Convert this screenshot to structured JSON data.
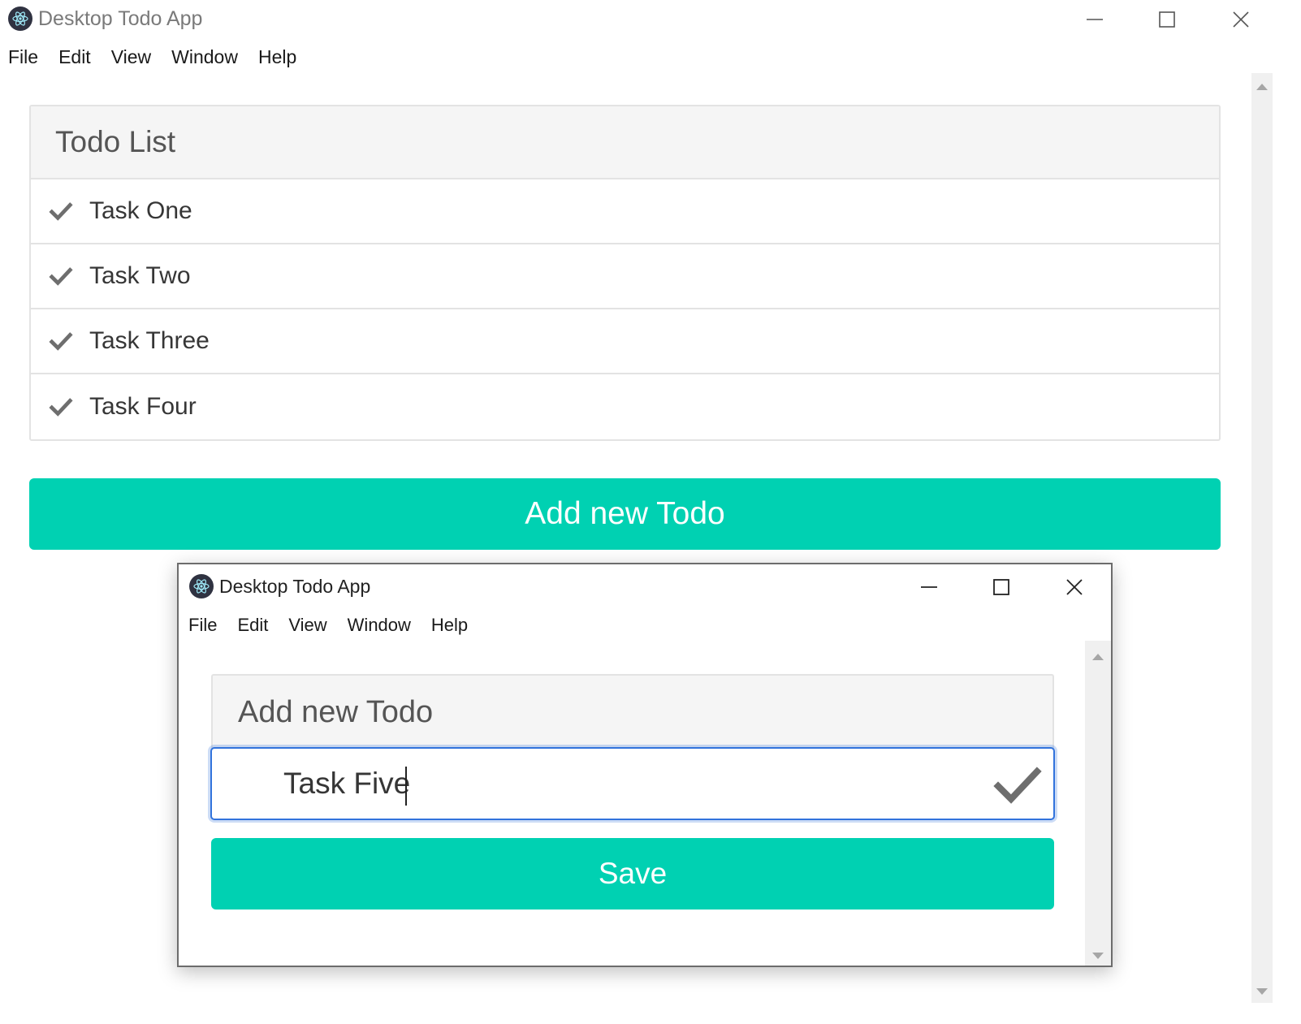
{
  "main_window": {
    "title": "Desktop Todo App",
    "menu": [
      "File",
      "Edit",
      "View",
      "Window",
      "Help"
    ],
    "panel": {
      "heading": "Todo List",
      "tasks": [
        "Task One",
        "Task Two",
        "Task Three",
        "Task Four"
      ]
    },
    "add_button_label": "Add new Todo"
  },
  "dialog_window": {
    "title": "Desktop Todo App",
    "menu": [
      "File",
      "Edit",
      "View",
      "Window",
      "Help"
    ],
    "heading": "Add new Todo",
    "input_value": "Task Five",
    "save_button_label": "Save"
  },
  "colors": {
    "accent": "#00d1b2",
    "focus": "#3273dc",
    "panel_bg": "#f5f5f5",
    "app_icon_bg": "#2f3241"
  },
  "icons": [
    "electron-app-icon",
    "minimize-icon",
    "maximize-icon",
    "close-icon",
    "checkmark-icon",
    "scroll-up-icon",
    "scroll-down-icon"
  ]
}
